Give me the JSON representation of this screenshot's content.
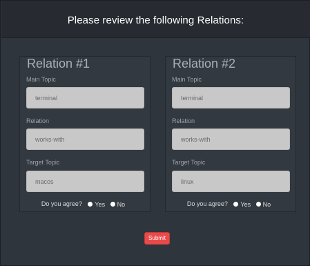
{
  "header": {
    "title": "Please review the following Relations:"
  },
  "relations": [
    {
      "title": "Relation #1",
      "main_topic_label": "Main Topic",
      "main_topic_value": "terminal",
      "relation_label": "Relation",
      "relation_value": "works-with",
      "target_topic_label": "Target Topic",
      "target_topic_value": "macos",
      "agree_question": "Do you agree?",
      "yes_label": "Yes",
      "no_label": "No"
    },
    {
      "title": "Relation #2",
      "main_topic_label": "Main Topic",
      "main_topic_value": "terminal",
      "relation_label": "Relation",
      "relation_value": "works-with",
      "target_topic_label": "Target Topic",
      "target_topic_value": "linux",
      "agree_question": "Do you agree?",
      "yes_label": "Yes",
      "no_label": "No"
    }
  ],
  "submit": {
    "label": "Submit"
  },
  "colors": {
    "background": "#2f353c",
    "header": "#272b31",
    "field": "#c8c8c8",
    "submit": "#e84a4a"
  }
}
